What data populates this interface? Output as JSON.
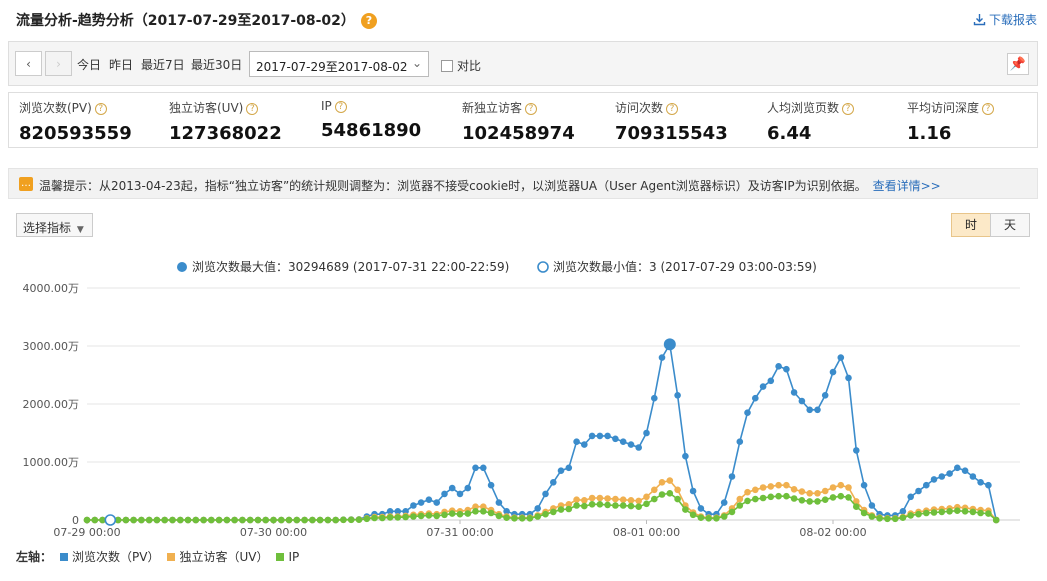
{
  "header": {
    "title": "流量分析-趋势分析（2017-07-29至2017-08-02）",
    "help": "?",
    "download_label": "下载报表"
  },
  "toolbar": {
    "prev": "‹",
    "next": "›",
    "quick_ranges": [
      "今日",
      "昨日",
      "最近7日",
      "最近30日"
    ],
    "date_range": "2017-07-29至2017-08-02",
    "compare_label": "对比"
  },
  "metrics": [
    {
      "label": "浏览次数(PV)",
      "value": "820593559"
    },
    {
      "label": "独立访客(UV)",
      "value": "127368022"
    },
    {
      "label": "IP",
      "value": "54861890"
    },
    {
      "label": "新独立访客",
      "value": "102458974"
    },
    {
      "label": "访问次数",
      "value": "709315543"
    },
    {
      "label": "人均浏览页数",
      "value": "6.44"
    },
    {
      "label": "平均访问深度",
      "value": "1.16"
    }
  ],
  "notice": {
    "text": "温馨提示：从2013-04-23起，指标“独立访客”的统计规则调整为：浏览器不接受cookie时，以浏览器UA（User Agent浏览器标识）及访客IP为识别依据。",
    "link": "查看详情>>"
  },
  "controls": {
    "select_metric": "选择指标",
    "hour": "时",
    "day": "天"
  },
  "annotations": {
    "max": "浏览次数最大值：30294689 (2017-07-31 22:00-22:59)",
    "min": "浏览次数最小值：3 (2017-07-29 03:00-03:59)"
  },
  "chart_data": {
    "type": "line",
    "y_unit": "万",
    "ylim": [
      0,
      4000
    ],
    "yticks": [
      "0",
      "1000.00万",
      "2000.00万",
      "3000.00万",
      "4000.00万"
    ],
    "x_ticks": [
      "07-29 00:00",
      "07-30 00:00",
      "07-31 00:00",
      "08-01 00:00",
      "08-02 00:00"
    ],
    "grid": true,
    "legend_position": "bottom-left",
    "legend_prefix": "左轴：",
    "colors": {
      "pv": "#3b8ccb",
      "uv": "#f0b050",
      "ip": "#6fbf3c"
    },
    "series": [
      {
        "name": "浏览次数（PV）",
        "key": "pv",
        "values": [
          0,
          0,
          0,
          0,
          0,
          0,
          0,
          0,
          0,
          0,
          0,
          0,
          0,
          0,
          0,
          0,
          0,
          0,
          0,
          0,
          0,
          0,
          0,
          0,
          0,
          0,
          0,
          0,
          0,
          0,
          0,
          0,
          0,
          5,
          8,
          10,
          60,
          100,
          100,
          150,
          150,
          150,
          250,
          300,
          350,
          300,
          450,
          550,
          450,
          550,
          900,
          900,
          600,
          300,
          150,
          100,
          100,
          100,
          200,
          450,
          650,
          850,
          900,
          1350,
          1300,
          1450,
          1450,
          1450,
          1400,
          1350,
          1300,
          1250,
          1500,
          2100,
          2800,
          3029,
          2150,
          1100,
          500,
          200,
          100,
          100,
          300,
          750,
          1350,
          1850,
          2100,
          2300,
          2400,
          2650,
          2600,
          2200,
          2050,
          1900,
          1900,
          2150,
          2550,
          2800,
          2450,
          1200,
          600,
          250,
          100,
          80,
          80,
          150,
          400,
          500,
          600,
          700,
          750,
          800,
          900,
          850,
          750,
          650,
          600,
          0
        ]
      },
      {
        "name": "独立访客（UV）",
        "key": "uv",
        "values": [
          0,
          0,
          0,
          0,
          0,
          0,
          0,
          0,
          0,
          0,
          0,
          0,
          0,
          0,
          0,
          0,
          0,
          0,
          0,
          0,
          0,
          0,
          0,
          0,
          0,
          0,
          0,
          0,
          0,
          0,
          0,
          0,
          0,
          4,
          6,
          8,
          30,
          50,
          50,
          60,
          60,
          70,
          90,
          100,
          110,
          100,
          140,
          160,
          150,
          170,
          230,
          230,
          170,
          100,
          60,
          40,
          40,
          40,
          80,
          140,
          200,
          250,
          270,
          350,
          340,
          380,
          380,
          370,
          360,
          350,
          340,
          330,
          400,
          520,
          650,
          680,
          520,
          250,
          130,
          60,
          40,
          40,
          80,
          200,
          360,
          480,
          520,
          560,
          580,
          600,
          600,
          530,
          490,
          460,
          460,
          500,
          560,
          600,
          560,
          320,
          170,
          80,
          40,
          30,
          30,
          50,
          110,
          140,
          160,
          180,
          190,
          200,
          220,
          210,
          190,
          170,
          160,
          0
        ]
      },
      {
        "name": "IP",
        "key": "ip",
        "values": [
          0,
          0,
          0,
          0,
          0,
          0,
          0,
          0,
          0,
          0,
          0,
          0,
          0,
          0,
          0,
          0,
          0,
          0,
          0,
          0,
          0,
          0,
          0,
          0,
          0,
          0,
          0,
          0,
          0,
          0,
          0,
          0,
          0,
          3,
          4,
          6,
          20,
          35,
          35,
          45,
          45,
          50,
          60,
          70,
          80,
          70,
          90,
          110,
          100,
          110,
          150,
          150,
          120,
          70,
          40,
          30,
          30,
          30,
          60,
          100,
          140,
          180,
          190,
          250,
          240,
          270,
          270,
          260,
          250,
          250,
          240,
          230,
          280,
          360,
          440,
          460,
          360,
          180,
          90,
          40,
          30,
          30,
          60,
          140,
          250,
          330,
          360,
          380,
          400,
          410,
          410,
          370,
          340,
          320,
          320,
          350,
          390,
          410,
          390,
          230,
          120,
          60,
          30,
          20,
          20,
          40,
          80,
          100,
          120,
          130,
          140,
          150,
          160,
          150,
          140,
          120,
          110,
          0
        ]
      }
    ],
    "max_point": {
      "series": "pv",
      "index": 75
    },
    "min_point": {
      "series": "pv",
      "index": 3
    }
  }
}
